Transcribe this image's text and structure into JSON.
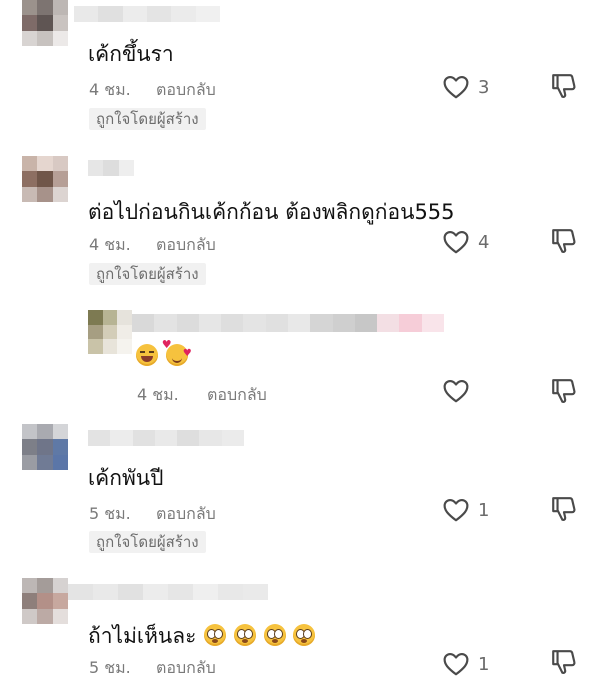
{
  "comments": [
    {
      "text": "เค้กขึ้นรา",
      "time": "4 ชม.",
      "reply": "ตอบกลับ",
      "likes": "3",
      "creator_badge": "ถูกใจโดยผู้สร้าง",
      "avatar_colors": [
        "#9b928c",
        "#7d7471",
        "#bdb7b4",
        "#7e6b68",
        "#5f5553",
        "#c9c3c0",
        "#d8d4d2",
        "#c7c2bf",
        "#ece9e8"
      ],
      "name_colors": [
        "#e9e9e9",
        "#e0e0e0",
        "#ececec",
        "#e4e4e4",
        "#ebebeb",
        "#f0f0f0"
      ]
    },
    {
      "text": "ต่อไปก่อนกินเค้กก้อน ต้องพลิกดูก่อน555",
      "time": "4 ชม.",
      "reply": "ตอบกลับ",
      "likes": "4",
      "creator_badge": "ถูกใจโดยผู้สร้าง",
      "avatar_colors": [
        "#c9b4a9",
        "#e5d6cf",
        "#d8c9c3",
        "#8d6f62",
        "#705649",
        "#b69f96",
        "#c8bab4",
        "#a7928a",
        "#dcd4d1"
      ],
      "name_colors": [
        "#e6e6e6",
        "#dddddd",
        "#eeeeee"
      ]
    },
    {
      "time": "4 ชม.",
      "reply": "ตอบกลับ",
      "emojis": [
        "face-with-tears-of-joy-emoji",
        "smiling-face-with-hearts-emoji"
      ],
      "avatar_colors": [
        "#7d7a52",
        "#b7b494",
        "#e6e3dc",
        "#a69e82",
        "#d3cdb8",
        "#f0ede7",
        "#c9c3a8",
        "#e8e4da",
        "#f5f3ee"
      ],
      "name_colors": [
        "#d9d9d9",
        "#e3e3e3",
        "#dcdcdc",
        "#e6e6e6",
        "#dedede",
        "#e4e4e4",
        "#e0e0e0",
        "#e8e8e8",
        "#d5d5d5",
        "#cfcfcf",
        "#c7c7c7",
        "#f3dfe4",
        "#f6cdd8",
        "#f9e4ea"
      ]
    },
    {
      "text": "เค้กพันปี",
      "time": "5 ชม.",
      "reply": "ตอบกลับ",
      "likes": "1",
      "creator_badge": "ถูกใจโดยผู้สร้าง",
      "avatar_colors": [
        "#c3c4c8",
        "#a9aab0",
        "#d4d5d8",
        "#7d7f88",
        "#6f7589",
        "#5f79a6",
        "#9a9ca3",
        "#707b95",
        "#5b76a8"
      ],
      "name_colors": [
        "#e3e3e3",
        "#ececec",
        "#e1e1e1",
        "#e9e9e9",
        "#dedede",
        "#e7e7e7",
        "#ebebeb"
      ]
    },
    {
      "text": "ถ้าไม่เห็นละ",
      "time": "5 ชม.",
      "reply": "ตอบกลับ",
      "likes": "1",
      "emojis": [
        "flushed-face-emoji",
        "flushed-face-emoji",
        "flushed-face-emoji",
        "flushed-face-emoji"
      ],
      "avatar_colors": [
        "#bdb7b5",
        "#a49c99",
        "#d6d2d1",
        "#8e7f7b",
        "#b39088",
        "#c7a89f",
        "#cfc9c7",
        "#bcaaa5",
        "#e4dedc"
      ],
      "name_colors": [
        "#e4e4e4",
        "#e9e9e9",
        "#e1e1e1",
        "#ececec",
        "#e6e6e6",
        "#efefef",
        "#e8e8e8",
        "#eaeaea"
      ]
    }
  ]
}
